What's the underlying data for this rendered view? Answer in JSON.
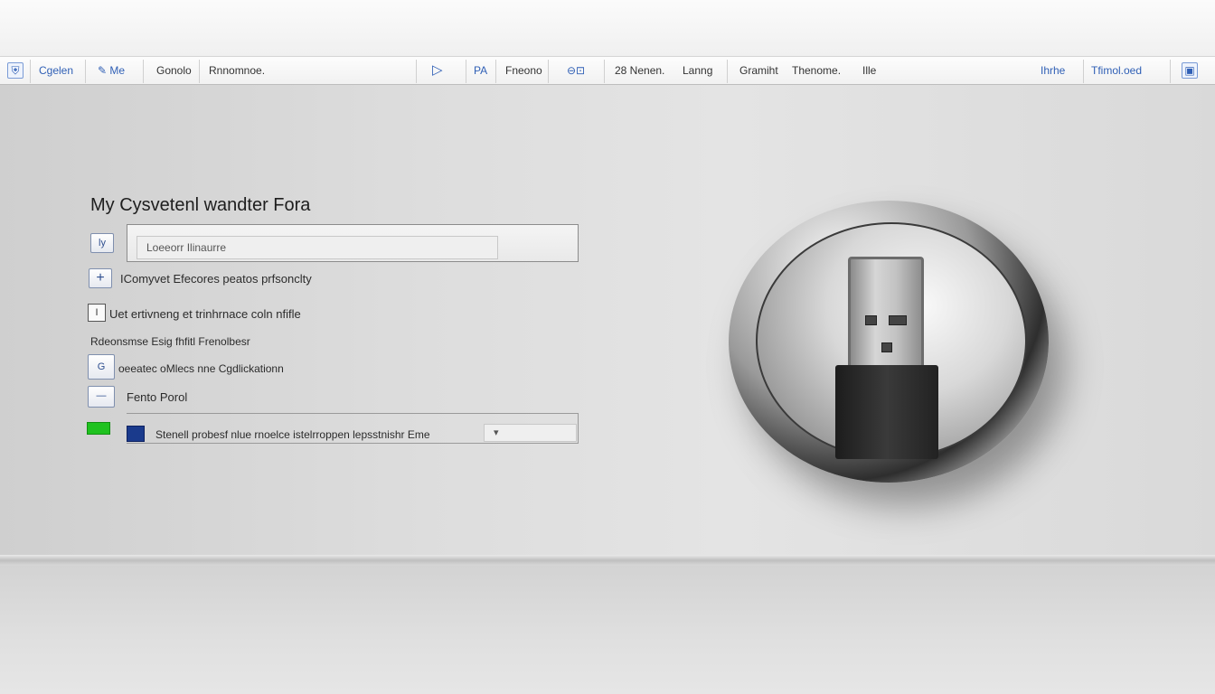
{
  "toolbar": {
    "items": [
      {
        "label": "Cgelen"
      },
      {
        "label": "Me"
      },
      {
        "label": "Gonolo"
      },
      {
        "label": "Rnnomnoe."
      },
      {
        "label": "PA"
      },
      {
        "label": "Fneono"
      },
      {
        "label": "28 Nenen."
      },
      {
        "label": "Lanng"
      },
      {
        "label": "Gramiht"
      },
      {
        "label": "Thenome."
      },
      {
        "label": "Ille"
      },
      {
        "label": "Ihrhe"
      },
      {
        "label": "Tfimol.oed"
      }
    ]
  },
  "form": {
    "title": "My Cysvetenl wandter Fora",
    "field_button": "ly",
    "field_placeholder": "Loeeorr Ilinaurre",
    "row1_label": "IComyvet Efecores peatos prfsonclty",
    "row2_label": "Uet ertivneng et trinhrnace coln nfifle",
    "row3_label": "Rdeonsmse Esig fhfitl Frenolbesr",
    "row4_label": "oeeatec oMlecs nne Cgdlickationn",
    "row5_label": "Fento Porol",
    "row6_label": "Stenell probesf nlue rnoelce istelrroppen lepsstnishr Eme",
    "row1_btn": "+",
    "row4_btn": "G",
    "row5_btn": "—"
  },
  "colors": {
    "accent_blue": "#2f5fb5",
    "green_indicator": "#1fc21f",
    "navy_indicator": "#1a3a8c"
  },
  "icons": {
    "toolbar_start": "shield-icon",
    "usb": "usb-drive-icon",
    "play": "play-icon",
    "window": "window-icon"
  }
}
